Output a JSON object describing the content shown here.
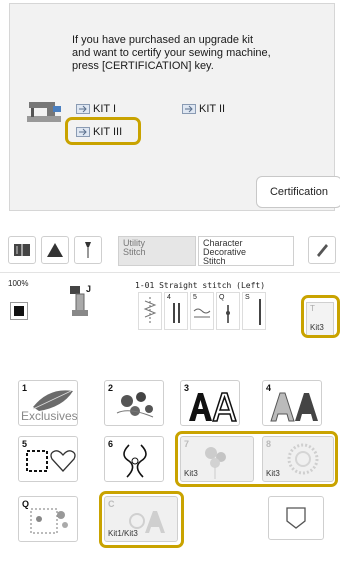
{
  "certification": {
    "message_lines": [
      "If you have purchased an upgrade kit",
      "and want to certify your sewing machine,",
      "press [CERTIFICATION] key."
    ],
    "kits": [
      "KIT I",
      "KIT II",
      "KIT III"
    ],
    "certification_button": "Certification"
  },
  "toolbar": {
    "tab_utility": [
      "Utility",
      "Stitch"
    ],
    "tab_character": [
      "Character",
      "Decorative",
      "Stitch"
    ],
    "zoom": "100%",
    "foot_letter": "J",
    "stitch_title": "1-01 Straight stitch (Left)",
    "stitch_tiles": [
      "",
      "4",
      "5",
      "Q",
      "S"
    ],
    "kit3_tile": {
      "top": "T",
      "label": "Kit3"
    }
  },
  "categories": [
    {
      "num": "1",
      "sub": "Exclusives"
    },
    {
      "num": "2",
      "sub": ""
    },
    {
      "num": "3",
      "sub": ""
    },
    {
      "num": "4",
      "sub": ""
    },
    {
      "num": "5",
      "sub": ""
    },
    {
      "num": "6",
      "sub": ""
    },
    {
      "num": "7",
      "sub": "Kit3"
    },
    {
      "num": "8",
      "sub": "Kit3"
    },
    {
      "num": "Q",
      "sub": ""
    },
    {
      "num": "C",
      "sub": "Kit1/Kit3"
    }
  ],
  "colors": {
    "highlight": "#c9a300",
    "panel_bg": "#f2f2f2"
  }
}
